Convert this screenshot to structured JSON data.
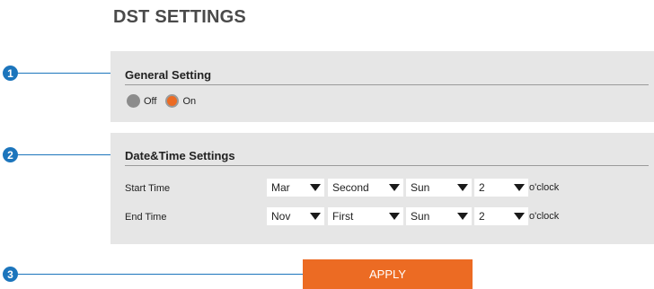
{
  "page": {
    "title": "DST SETTINGS"
  },
  "callouts": [
    "1",
    "2",
    "3"
  ],
  "general": {
    "title": "General Setting",
    "options": [
      {
        "label": "Off",
        "selected": false
      },
      {
        "label": "On",
        "selected": true
      }
    ]
  },
  "datetime": {
    "title": "Date&Time Settings",
    "start": {
      "label": "Start Time",
      "month": "Mar",
      "week": "Second",
      "day": "Sun",
      "hour": "2",
      "unit": "o'clock"
    },
    "end": {
      "label": "End Time",
      "month": "Nov",
      "week": "First",
      "day": "Sun",
      "hour": "2",
      "unit": "o'clock"
    }
  },
  "apply": {
    "label": "APPLY"
  },
  "colors": {
    "accent": "#ec6b23",
    "callout": "#1c75bc",
    "panel": "#e6e6e6"
  }
}
